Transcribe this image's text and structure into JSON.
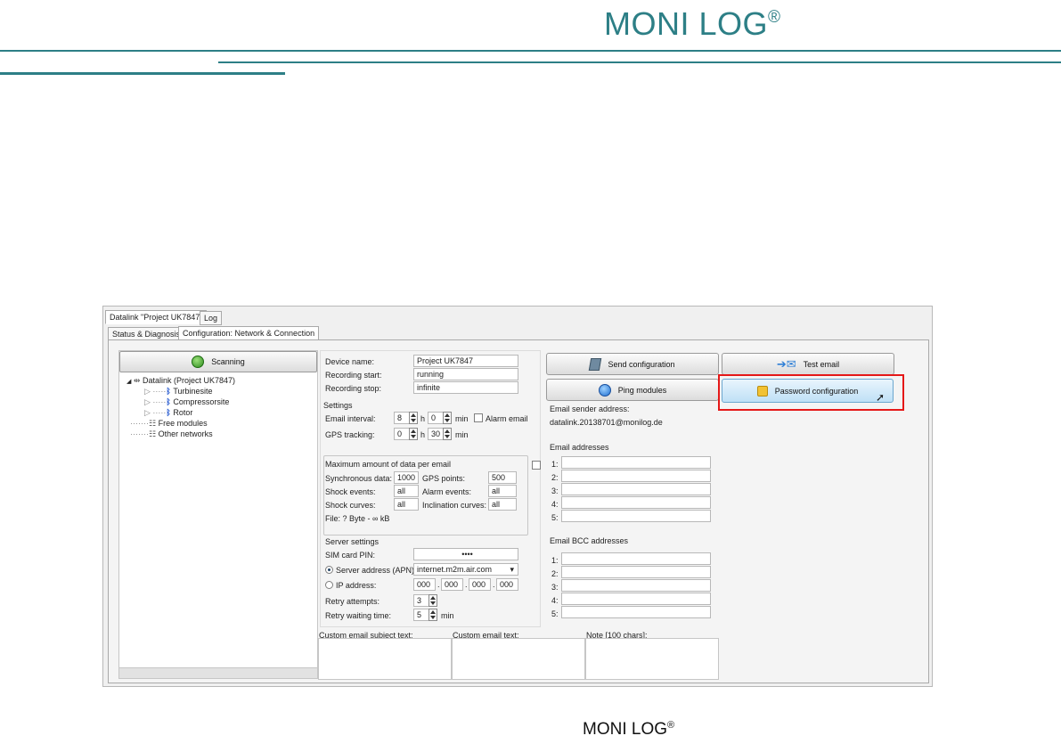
{
  "brand": {
    "top_logo": "MONI LOG",
    "top_logo_mark": "®",
    "bottom_logo": "MONI LOG",
    "bottom_logo_mark": "®"
  },
  "tabs_top": [
    "Datalink \"Project UK7847\"",
    "Log"
  ],
  "tabs_sub": [
    "Status & Diagnosis",
    "Configuration: Network & Connection"
  ],
  "scan_button": "Scanning",
  "tree": {
    "root": "Datalink (Project UK7847)",
    "children": [
      "Turbinesite",
      "Compressorsite",
      "Rotor"
    ],
    "free_modules": "Free modules",
    "other_networks": "Other networks"
  },
  "device": {
    "name_label": "Device name:",
    "name_value": "Project UK7847",
    "start_label": "Recording start:",
    "start_value": "running",
    "stop_label": "Recording stop:",
    "stop_value": "infinite"
  },
  "settings": {
    "title": "Settings",
    "email_interval_label": "Email interval:",
    "email_interval_h": "8",
    "email_interval_min": "0",
    "h_label": "h",
    "min_label": "min",
    "alarm_email_label": "Alarm email",
    "gps_label": "GPS tracking:",
    "gps_h": "0",
    "gps_min": "30"
  },
  "max_data": {
    "title": "Maximum amount of data per email",
    "sync_label": "Synchronous data:",
    "sync_value": "1000",
    "gps_points_label": "GPS points:",
    "gps_points_value": "500",
    "shock_events_label": "Shock events:",
    "shock_events_value": "all",
    "alarm_events_label": "Alarm events:",
    "alarm_events_value": "all",
    "shock_curves_label": "Shock curves:",
    "shock_curves_value": "all",
    "incl_curves_label": "Inclination curves:",
    "incl_curves_value": "all",
    "file_text": "File: ? Byte - ∞ kB"
  },
  "server": {
    "title": "Server settings",
    "sim_label": "SIM card PIN:",
    "sim_value": "••••",
    "apn_label": "Server address (APN):",
    "apn_value": "internet.m2m.air.com",
    "ip_label": "IP address:",
    "ip_values": [
      "000",
      "000",
      "000",
      "000"
    ],
    "retry_label": "Retry attempts:",
    "retry_value": "3",
    "wait_label": "Retry waiting time:",
    "wait_value": "5",
    "wait_unit": "min"
  },
  "bottom_fields": {
    "subject_label": "Custom email subject text:",
    "text_label": "Custom email text:",
    "note_label": "Note [100 chars]:"
  },
  "actions": {
    "send_config": "Send configuration",
    "ping": "Ping modules",
    "test_email": "Test email",
    "password": "Password configuration"
  },
  "email": {
    "sender_label": "Email sender address:",
    "sender_value": "datalink.20138701@monilog.de",
    "addresses_label": "Email addresses",
    "bcc_label": "Email BCC addresses",
    "row_labels": [
      "1:",
      "2:",
      "3:",
      "4:",
      "5:"
    ]
  },
  "colors": {
    "brand_teal": "#2d7f86",
    "highlight_red": "#e51818",
    "button_highlight": "#bfe0f6"
  }
}
